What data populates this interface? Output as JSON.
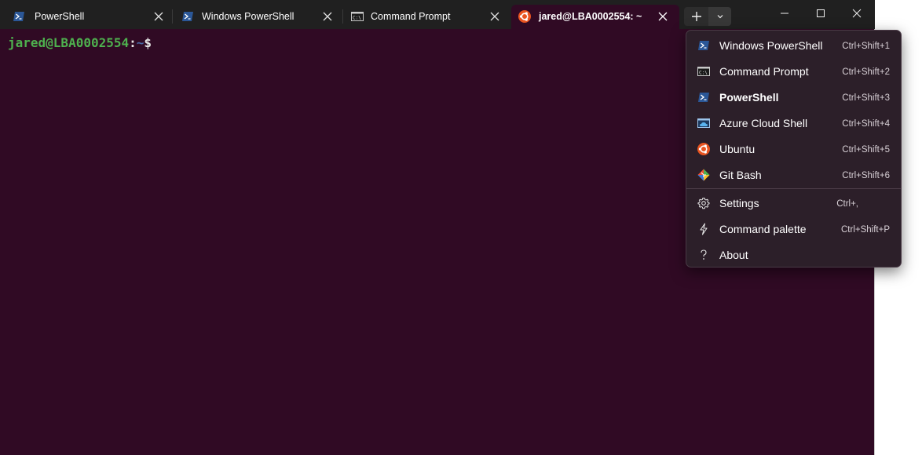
{
  "tabs": [
    {
      "title": "PowerShell",
      "icon": "powershell-icon"
    },
    {
      "title": "Windows PowerShell",
      "icon": "powershell-icon"
    },
    {
      "title": "Command Prompt",
      "icon": "command-prompt-icon"
    },
    {
      "title": "jared@LBA0002554: ~",
      "icon": "ubuntu-icon",
      "active": true
    }
  ],
  "terminal": {
    "user_host": "jared@LBA0002554",
    "colon": ":",
    "path": "~",
    "dollar": "$"
  },
  "menu": {
    "profiles": [
      {
        "label": "Windows PowerShell",
        "shortcut": "Ctrl+Shift+1",
        "icon": "powershell-icon"
      },
      {
        "label": "Command Prompt",
        "shortcut": "Ctrl+Shift+2",
        "icon": "command-prompt-icon"
      },
      {
        "label": "PowerShell",
        "shortcut": "Ctrl+Shift+3",
        "icon": "powershell-icon",
        "default": true
      },
      {
        "label": "Azure Cloud Shell",
        "shortcut": "Ctrl+Shift+4",
        "icon": "azure-cloud-shell-icon"
      },
      {
        "label": "Ubuntu",
        "shortcut": "Ctrl+Shift+5",
        "icon": "ubuntu-icon"
      },
      {
        "label": "Git Bash",
        "shortcut": "Ctrl+Shift+6",
        "icon": "git-icon"
      }
    ],
    "actions": [
      {
        "label": "Settings",
        "shortcut": "Ctrl+,",
        "icon": "gear-icon"
      },
      {
        "label": "Command palette",
        "shortcut": "Ctrl+Shift+P",
        "icon": "lightning-icon"
      },
      {
        "label": "About",
        "shortcut": "",
        "icon": "question-icon"
      }
    ]
  },
  "colors": {
    "terminal_bg": "#300a24",
    "titlebar_bg": "#202020",
    "prompt_user": "#4eb04e",
    "prompt_path": "#4a6ba8",
    "ubuntu_orange": "#e95420"
  }
}
